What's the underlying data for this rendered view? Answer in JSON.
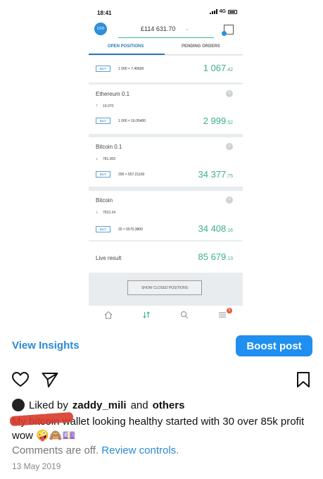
{
  "phone": {
    "status": {
      "time": "18:41",
      "network": "4G"
    },
    "header": {
      "logo": "CFD",
      "balance": "£114 631.70"
    },
    "tabs": {
      "open": "OPEN POSITIONS",
      "pending": "PENDING ORDERS"
    },
    "positions": [
      {
        "title": "",
        "arrow": "",
        "rate": "",
        "side": "BUY",
        "qty": "1 000",
        "price": "7.49600",
        "value_main": "1 067",
        "value_dec": ".42"
      },
      {
        "title": "Ethereum 0.1",
        "arrow": "↑",
        "rate": "19.970",
        "side": "BUY",
        "qty": "1 000",
        "price": "16.05400",
        "value_main": "2 999",
        "value_dec": ".52"
      },
      {
        "title": "Bitcoin 0.1",
        "arrow": "↓",
        "rate": "781.009",
        "side": "BUY",
        "qty": "200",
        "price": "557.21100",
        "value_main": "34 377",
        "value_dec": ".75"
      },
      {
        "title": "Bitcoin",
        "arrow": "↓",
        "rate": "7810.34",
        "side": "BUY",
        "qty": "20",
        "price": "5570.3800",
        "value_main": "34 408",
        "value_dec": ".16"
      }
    ],
    "live_result": {
      "label": "Live result",
      "value_main": "85 679",
      "value_dec": ".13"
    },
    "show_closed_label": "SHOW CLOSED POSITIONS",
    "notification_count": "5",
    "multiply_sign": "×",
    "close_sign": "×"
  },
  "post": {
    "view_insights": "View Insights",
    "boost_post": "Boost post",
    "liked_prefix": "Liked by",
    "liked_user": "zaddy_mili",
    "liked_and": "and",
    "liked_others": "others",
    "caption": "My bitcoin wallet looking healthy started with 30 over 85k profit wow 🤪🙈💷",
    "comments_off": "Comments are off.",
    "review_controls": "Review controls.",
    "date": "13 May 2019"
  },
  "colors": {
    "accent_blue": "#1f8ff0",
    "profit_green": "#3fae8c",
    "redaction_red": "#d83a2a"
  }
}
